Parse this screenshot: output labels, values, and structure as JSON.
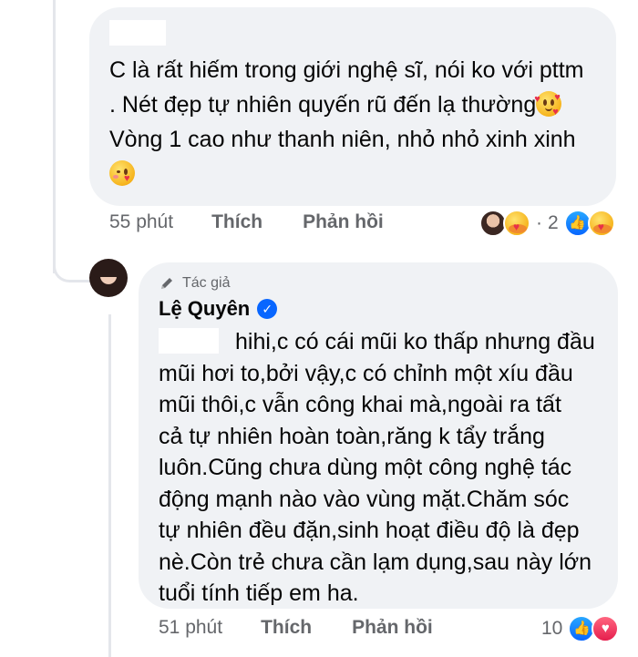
{
  "comment1": {
    "lines": [
      "C là rất hiếm trong giới nghệ sĩ, nói ko với pttm",
      ". Nét đẹp tự nhiên quyến rũ đến lạ thường",
      "Vòng 1 cao như thanh niên, nhỏ nhỏ xinh xinh"
    ],
    "emoji_after_line2": "smiling-face-with-hearts",
    "emoji_line4": "face-blowing-kiss",
    "time": "55 phút",
    "like_label": "Thích",
    "reply_label": "Phản hồi",
    "reaction_separator": "·",
    "reaction_count": "2",
    "reactions": [
      "care",
      "like",
      "care"
    ]
  },
  "comment2": {
    "author_badge": "Tác giả",
    "author_name": "Lệ Quyên",
    "lines": [
      "hihi,c có cái mũi ko thấp nhưng đầu",
      "mũi hơi to,bởi vậy,c có chỉnh một xíu đầu",
      "mũi thôi,c vẫn công khai mà,ngoài ra tất",
      "cả tự nhiên hoàn toàn,răng k tẩy trắng",
      "luôn.Cũng chưa dùng một công nghệ tác",
      "động mạnh nào vào vùng mặt.Chăm sóc",
      "tự nhiên đều đặn,sinh hoạt điều độ là đẹp",
      "nè.Còn trẻ chưa cần lạm dụng,sau này lớn",
      "tuổi tính tiếp em ha."
    ],
    "time": "51 phút",
    "like_label": "Thích",
    "reply_label": "Phản hồi",
    "reaction_count": "10",
    "reactions": [
      "like",
      "love"
    ]
  },
  "colors": {
    "bubble": "#f0f2f5",
    "meta_text": "#65676b",
    "like_blue": "#0866ff",
    "love_red": "#e61e4d"
  }
}
